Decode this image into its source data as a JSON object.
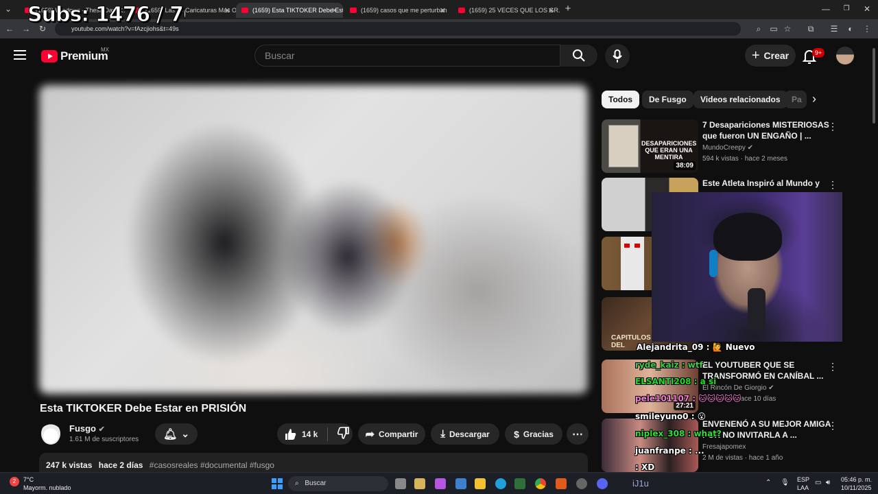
{
  "browser": {
    "tabs": [
      {
        "label": "(1659) Windows - These Days ..."
      },
      {
        "label": "(1659) Las 20 Caricaturas Más O..."
      },
      {
        "label": "(1659) Esta TIKTOKER Debe Esta"
      },
      {
        "label": "(1659) casos que me perturban"
      },
      {
        "label": "(1659) 25 VECES QUE LOS GR..."
      }
    ],
    "url": "youtube.com/watch?v=fAzcjiohs&t=49s",
    "overlay_subs": "Subs: 1476 / 700"
  },
  "youtube": {
    "logo_text": "Premium",
    "region": "MX",
    "search_placeholder": "Buscar",
    "create_label": "Crear",
    "notifications": "9+"
  },
  "video": {
    "title": "Esta TIKTOKER Debe Estar en PRISIÓN",
    "channel": "Fusgo",
    "subscribers": "1.61 M de suscriptores",
    "likes": "14 k",
    "share": "Compartir",
    "download": "Descargar",
    "thanks": "Gracias",
    "views": "247 k vistas",
    "date": "hace 2 días",
    "tags": "#casosreales #documental #fusgo"
  },
  "chips": [
    "Todos",
    "De Fusgo",
    "Videos relacionados",
    "Pa"
  ],
  "recommendations": [
    {
      "title": "7 Desapariciones MISTERIOSAS que fueron UN ENGAÑO | ...",
      "channel": "MundoCreepy",
      "meta": "594 k vistas · hace 2 meses",
      "duration": "38:09"
    },
    {
      "title": "Este Atleta Inspiró al Mundo y luego lo ...",
      "channel": "",
      "meta": "",
      "duration": ""
    },
    {
      "title": "",
      "channel": "",
      "meta": "",
      "duration": ""
    },
    {
      "title": "",
      "channel": "",
      "meta": "",
      "duration": ""
    },
    {
      "title": "EL YOUTUBER QUE SE TRANSFORMÓ EN CANÍBAL ...",
      "channel": "El Rincón De Giorgio",
      "meta": "hace 10 días",
      "duration": "27:21"
    },
    {
      "title": "ENVENENÓ A SU MEJOR AMIGA POR NO INVITARLA A ...",
      "channel": "Fresajapomex",
      "meta": "2 M de vistas · hace 1 año",
      "duration": ""
    }
  ],
  "chat": [
    {
      "text": "Alejandrita_09 : 🙋 Nuevo"
    },
    {
      "text": "ryde_kaiz : wtf"
    },
    {
      "text": "ELSANTI208 : a si"
    },
    {
      "text": "pele101107 : 🐱🐱🐱🐱🐱"
    },
    {
      "text": "smileyuno0 : 😮"
    },
    {
      "text": "niplex_308 : what?"
    },
    {
      "text": "juanfranpe : ..."
    },
    {
      "text": "                 : XD"
    }
  ],
  "taskbar": {
    "weather_temp": "7°C",
    "weather_desc": "Mayorm. nublado",
    "search_label": "Buscar",
    "lang_top": "ESP",
    "lang_bottom": "LAA",
    "time": "05:46 p. m.",
    "date": "10/11/2025",
    "stream_tag": "iJ1u"
  },
  "colors": {
    "brand_red": "#ff0033",
    "background": "#0f0f0f",
    "chip_bg": "#272727"
  }
}
